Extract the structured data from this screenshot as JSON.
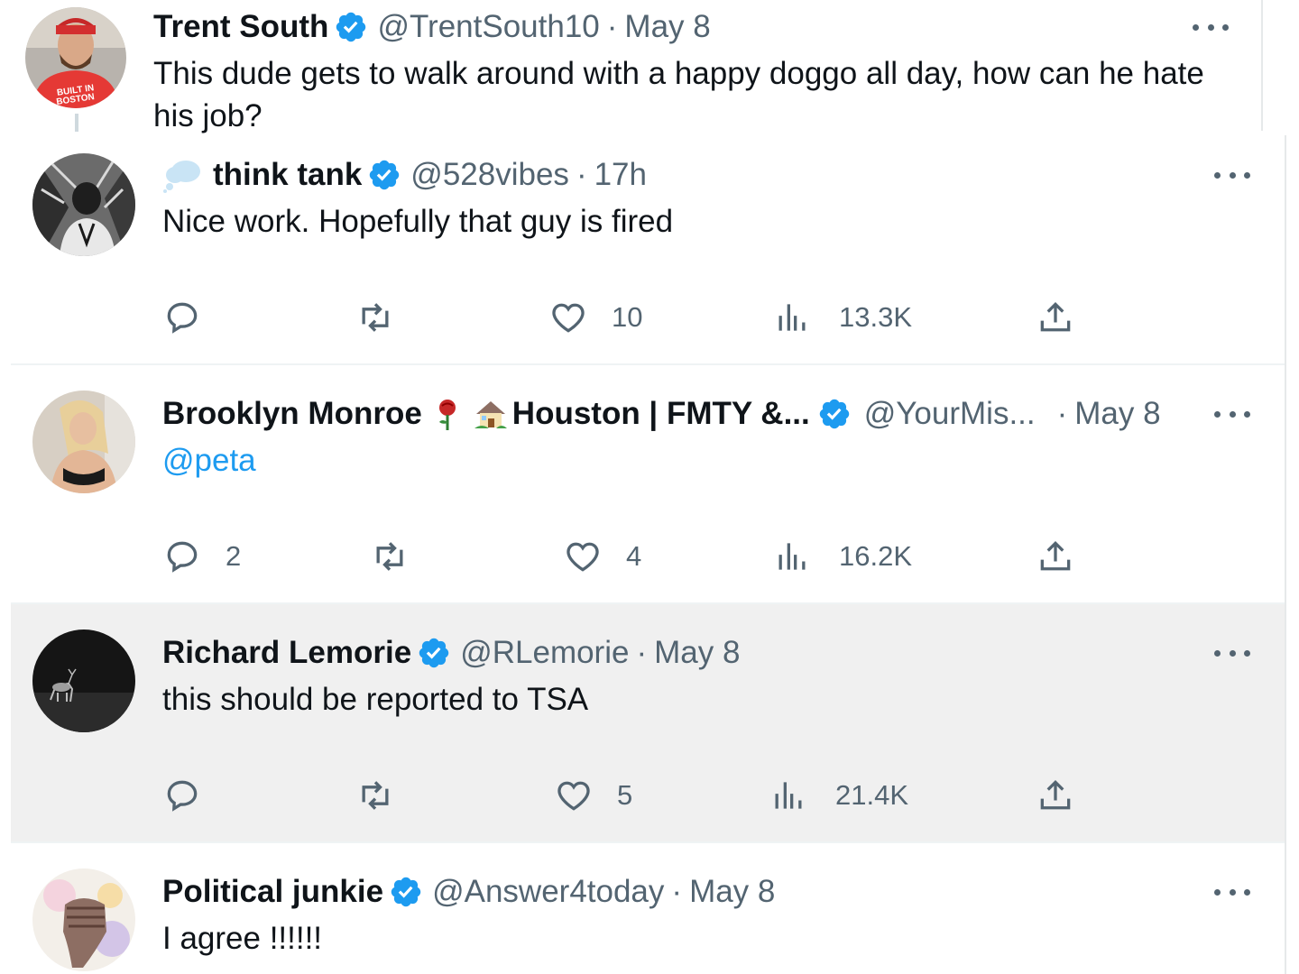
{
  "tweets": [
    {
      "name": "Trent South",
      "handle": "@TrentSouth10",
      "sep": "·",
      "time": "May 8",
      "text": "This dude gets to walk around with a happy doggo all day, how can he hate his job?",
      "avatar_text": [
        "BUILT IN",
        "BOSTON"
      ]
    },
    {
      "name": "think tank",
      "handle": "@528vibes",
      "sep": "·",
      "time": "17h",
      "text": "Nice work. Hopefully that guy is fired",
      "replies": "",
      "likes": "10",
      "views": "13.3K"
    },
    {
      "name_part1": "Brooklyn Monroe",
      "name_part2": "Houston | FMTY &...",
      "handle": "@YourMis...",
      "sep": "·",
      "time": "May 8",
      "mention": "@peta",
      "replies": "2",
      "likes": "4",
      "views": "16.2K"
    },
    {
      "name": "Richard Lemorie",
      "handle": "@RLemorie",
      "sep": "·",
      "time": "May 8",
      "text": "this should be reported to TSA",
      "replies": "",
      "likes": "5",
      "views": "21.4K"
    },
    {
      "name": "Political junkie",
      "handle": "@Answer4today",
      "sep": "·",
      "time": "May 8",
      "text": "I agree !!!!!!"
    }
  ],
  "icons": {
    "verified": "verified-badge-icon",
    "reply": "reply-icon",
    "retweet": "retweet-icon",
    "like": "heart-icon",
    "views": "views-icon",
    "share": "share-icon",
    "more": "more-icon"
  },
  "colors": {
    "verified_blue": "#1d9bf0",
    "mention_blue": "#1d9bf0",
    "secondary_text": "#536471",
    "highlight_bg": "#f0f0f0"
  }
}
